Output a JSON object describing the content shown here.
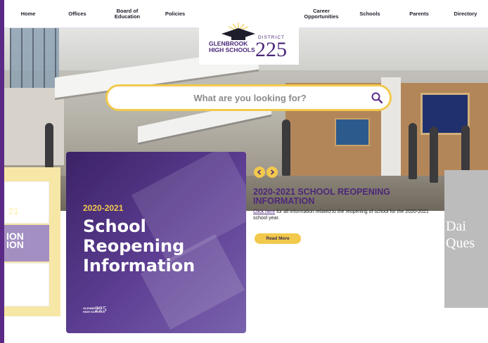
{
  "nav": {
    "items": [
      {
        "label": "Home"
      },
      {
        "label": "Offices"
      },
      {
        "label": "Board of Education"
      },
      {
        "label": "Policies"
      },
      {
        "label": "Career Opportunities"
      },
      {
        "label": "Schools"
      },
      {
        "label": "Parents"
      },
      {
        "label": "Directory"
      }
    ]
  },
  "logo": {
    "school_line1": "GLENBROOK",
    "school_line2": "HIGH SCHOOLS",
    "district_label": "DISTRICT",
    "district_number": "225"
  },
  "search": {
    "placeholder": "What are you looking for?"
  },
  "slider": {
    "prev_icon": "chevron-left-icon",
    "next_icon": "chevron-right-icon"
  },
  "side_card_left": {
    "year_fragment": "21",
    "title_fragment_1": "ION",
    "title_fragment_2": "ION"
  },
  "feature_card": {
    "year": "2020-2021",
    "title_line1": "School",
    "title_line2": "Reopening",
    "title_line3": "Information",
    "footer_small_1": "GLENBROOK",
    "footer_small_2": "HIGH SCHOOLS",
    "footer_number": "225"
  },
  "feature_info": {
    "title": "2020-2021 SCHOOL REOPENING INFORMATION",
    "link_text": "Click here",
    "body_text": " for all information related to the reopening of school for the 2020-2021 school year.",
    "button_label": "Read More"
  },
  "side_card_right": {
    "line1": "Dai",
    "line2": "Ques"
  },
  "colors": {
    "brand_purple": "#4b2779",
    "accent_gold": "#f2c94c"
  }
}
